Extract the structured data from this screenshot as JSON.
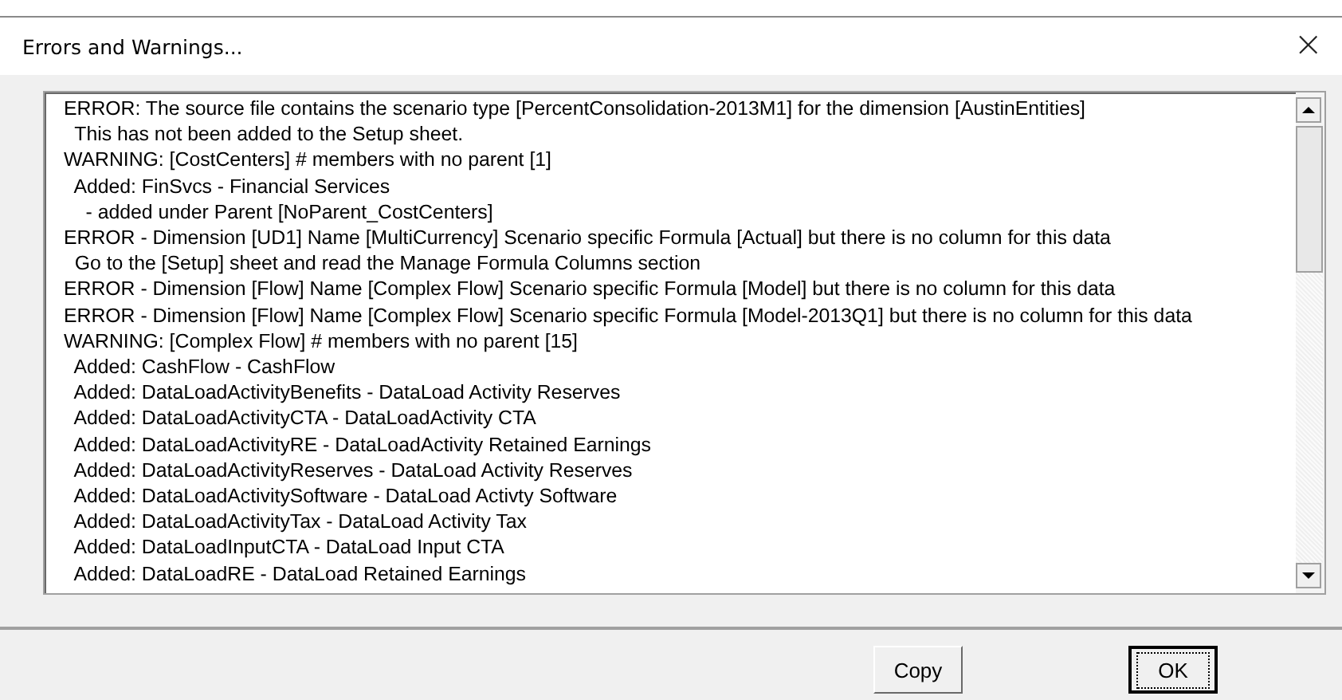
{
  "window": {
    "title": "Errors and Warnings..."
  },
  "close_button": {
    "label": "×"
  },
  "log_lines": [
    "ERROR: The source file contains the scenario type [PercentConsolidation-2013M1] for the dimension [AustinEntities]",
    "  This has not been added to the Setup sheet.",
    "WARNING: [CostCenters] # members with no parent [1]",
    "  Added: FinSvcs - Financial Services",
    "    - added under Parent [NoParent_CostCenters]",
    "ERROR - Dimension [UD1] Name [MultiCurrency] Scenario specific Formula [Actual] but there is no column for this data",
    "  Go to the [Setup] sheet and read the Manage Formula Columns section",
    "ERROR - Dimension [Flow] Name [Complex Flow] Scenario specific Formula [Model] but there is no column for this data",
    "ERROR - Dimension [Flow] Name [Complex Flow] Scenario specific Formula [Model-2013Q1] but there is no column for this data",
    "WARNING: [Complex Flow] # members with no parent [15]",
    "  Added: CashFlow - CashFlow",
    "  Added: DataLoadActivityBenefits - DataLoad Activity Reserves",
    "  Added: DataLoadActivityCTA - DataLoadActivity CTA",
    "  Added: DataLoadActivityRE - DataLoadActivity Retained Earnings",
    "  Added: DataLoadActivityReserves - DataLoad Activity Reserves",
    "  Added: DataLoadActivitySoftware - DataLoad Activty Software",
    "  Added: DataLoadActivityTax - DataLoad Activity Tax",
    "  Added: DataLoadInputCTA - DataLoad Input CTA",
    "  Added: DataLoadRE - DataLoad Retained Earnings"
  ],
  "buttons": [
    {
      "label": "Copy",
      "default": false
    },
    {
      "label": "OK",
      "default": true
    }
  ]
}
